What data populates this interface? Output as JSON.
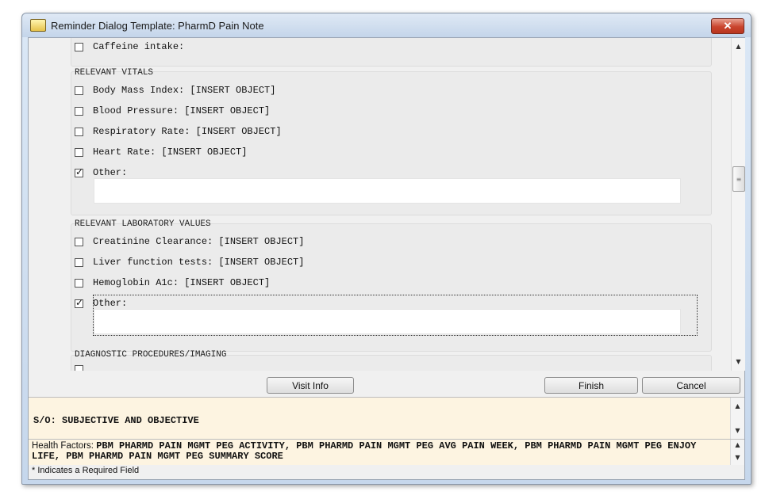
{
  "window": {
    "title": "Reminder Dialog Template: PharmD Pain Note",
    "close_glyph": "✕"
  },
  "dialog": {
    "caffeine": {
      "label": "Caffeine intake:",
      "checked": false
    },
    "vitals": {
      "heading": "RELEVANT VITALS",
      "items": [
        {
          "label": "Body Mass Index: [INSERT OBJECT]",
          "checked": false
        },
        {
          "label": "Blood Pressure: [INSERT OBJECT]",
          "checked": false
        },
        {
          "label": "Respiratory Rate: [INSERT OBJECT]",
          "checked": false
        },
        {
          "label": "Heart Rate: [INSERT OBJECT]",
          "checked": false
        },
        {
          "label": "Other:",
          "checked": true
        }
      ]
    },
    "labs": {
      "heading": "RELEVANT LABORATORY VALUES",
      "items": [
        {
          "label": "Creatinine Clearance: [INSERT OBJECT]",
          "checked": false
        },
        {
          "label": "Liver function tests: [INSERT OBJECT]",
          "checked": false
        },
        {
          "label": "Hemoglobin A1c: [INSERT OBJECT]",
          "checked": false
        },
        {
          "label": "Other:",
          "checked": true
        }
      ]
    },
    "diagnostics": {
      "heading": "DIAGNOSTIC PROCEDURES/IMAGING"
    }
  },
  "buttons": {
    "visit_info": "Visit Info",
    "finish": "Finish",
    "cancel": "Cancel"
  },
  "summary": {
    "text": "S/O: SUBJECTIVE AND OBJECTIVE"
  },
  "health_factors": {
    "label": "Health Factors:",
    "value": "PBM PHARMD PAIN MGMT PEG ACTIVITY, PBM PHARMD PAIN MGMT PEG AVG PAIN WEEK, PBM PHARMD PAIN MGMT PEG ENJOY LIFE, PBM PHARMD PAIN MGMT PEG SUMMARY SCORE"
  },
  "footer": {
    "required_note": "* Indicates a Required Field"
  },
  "icons": {
    "scroll_up": "▲",
    "scroll_down": "▼",
    "thumb_grip": "≡"
  }
}
